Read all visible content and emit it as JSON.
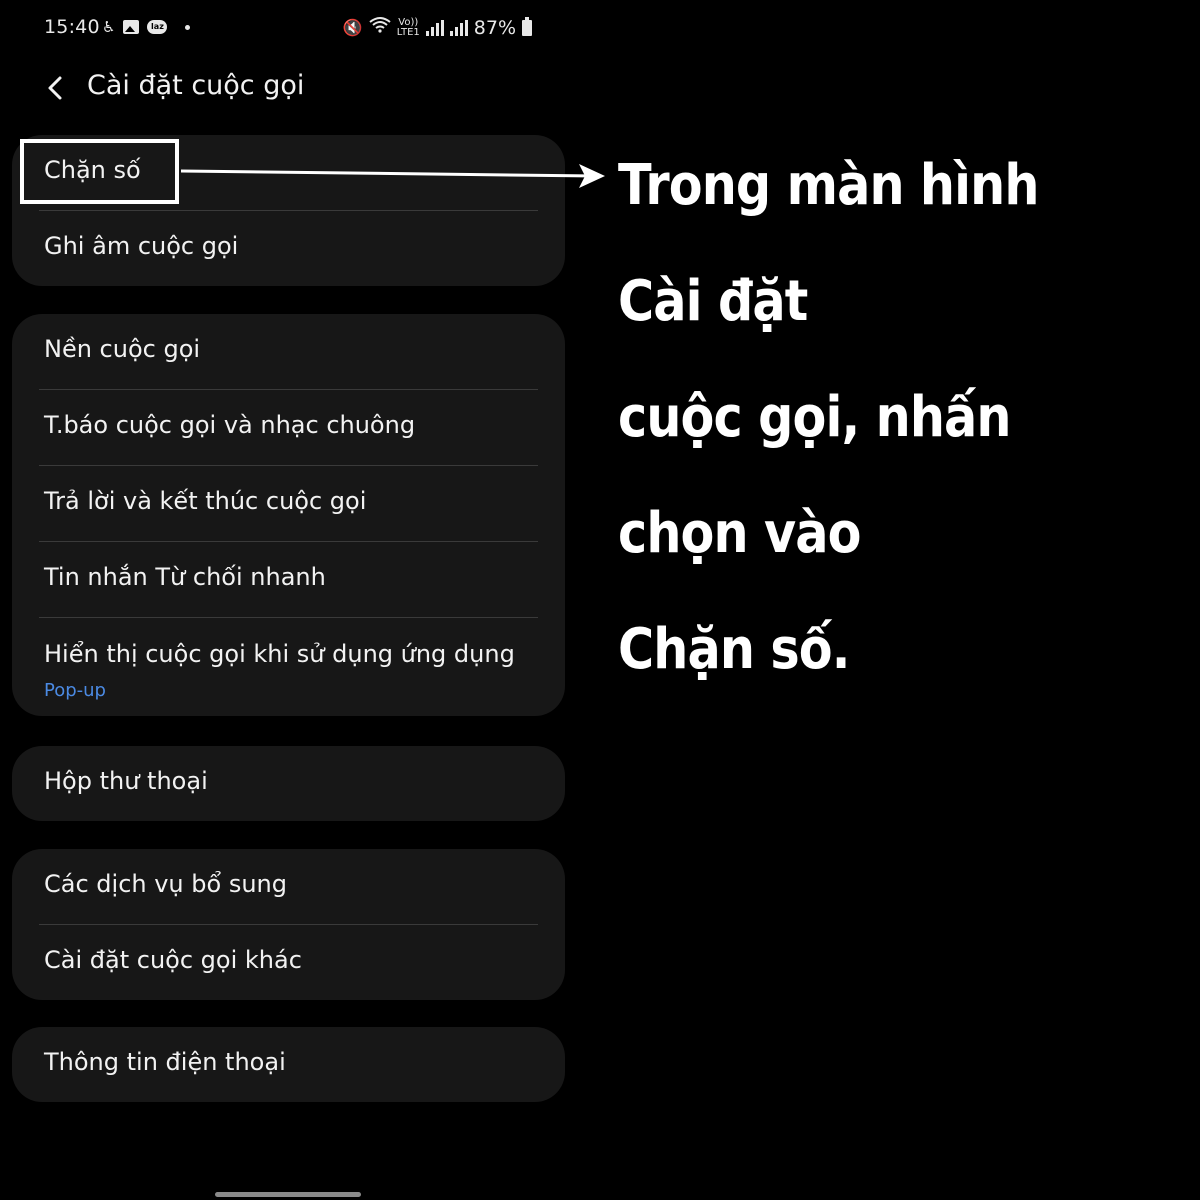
{
  "status_bar": {
    "time": "15:40",
    "left_icons": [
      "accessibility-icon",
      "image-icon",
      "lazada-icon",
      "notification-dot"
    ],
    "laz_text": "laz",
    "right_icons": [
      "mute-vibrate-icon",
      "wifi-icon",
      "volte-icon",
      "signal-1-icon",
      "signal-2-icon",
      "battery-icon"
    ],
    "volte_top": "Vo))",
    "volte_bottom": "LTE1",
    "battery": "87%"
  },
  "header": {
    "back_icon": "chevron-left-icon",
    "title": "Cài đặt cuộc gọi"
  },
  "groups": [
    {
      "items": [
        {
          "label": "Chặn số"
        },
        {
          "label": "Ghi âm cuộc gọi"
        }
      ]
    },
    {
      "items": [
        {
          "label": "Nền cuộc gọi"
        },
        {
          "label": "T.báo cuộc gọi và nhạc chuông"
        },
        {
          "label": "Trả lời và kết thúc cuộc gọi"
        },
        {
          "label": "Tin nhắn Từ chối nhanh"
        },
        {
          "label": "Hiển thị cuộc gọi khi sử dụng ứng dụng",
          "sub": "Pop-up"
        }
      ]
    },
    {
      "items": [
        {
          "label": "Hộp thư thoại"
        }
      ]
    },
    {
      "items": [
        {
          "label": "Các dịch vụ bổ sung"
        },
        {
          "label": "Cài đặt cuộc gọi khác"
        }
      ]
    },
    {
      "items": [
        {
          "label": "Thông tin điện thoại"
        }
      ]
    }
  ],
  "annotation": {
    "lines": [
      "Trong màn hình Cài đặt",
      "cuộc gọi, nhấn chọn vào",
      "Chặn số."
    ]
  },
  "colors": {
    "background": "#000000",
    "card": "#171717",
    "divider": "#3a3a3a",
    "accent": "#4b8ae3",
    "text": "#f2f2f2"
  }
}
